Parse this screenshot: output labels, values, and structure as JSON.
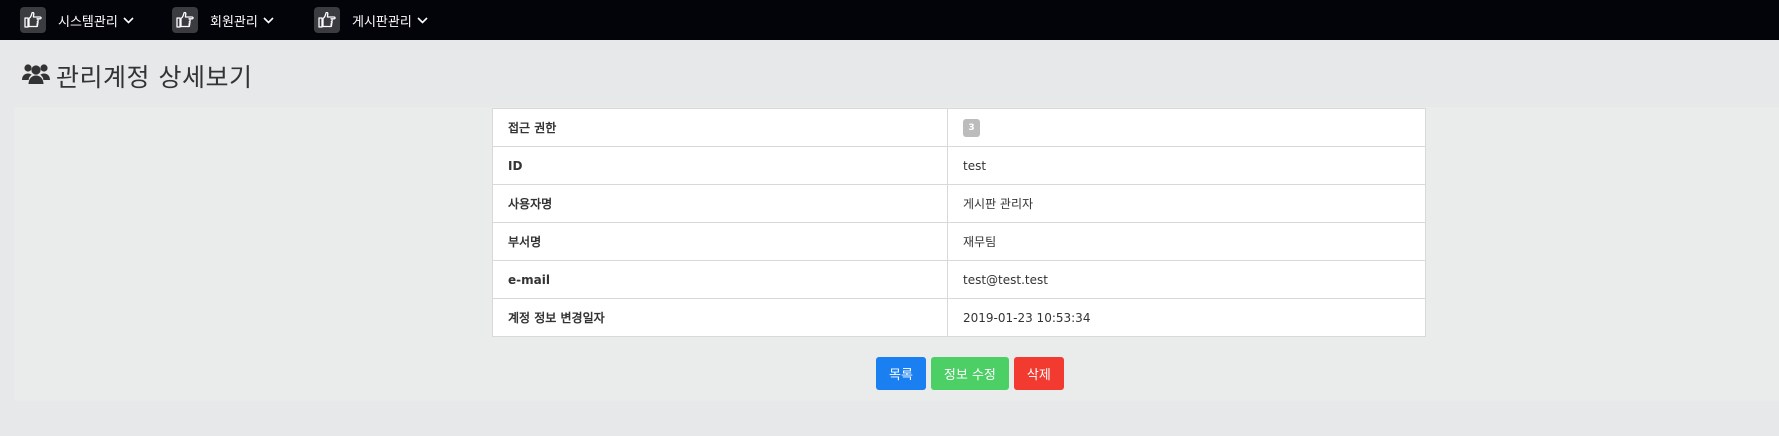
{
  "nav": {
    "items": [
      {
        "label": "시스템관리",
        "icon": "thumbs-up-point-icon"
      },
      {
        "label": "회원관리",
        "icon": "thumbs-up-point-icon"
      },
      {
        "label": "게시판관리",
        "icon": "thumbs-up-point-icon"
      }
    ]
  },
  "header": {
    "icon": "users-icon",
    "title": "관리계정 상세보기"
  },
  "detail": {
    "rows": [
      {
        "label": "접근 권한",
        "value": "3",
        "is_badge": true
      },
      {
        "label": "ID",
        "value": "test"
      },
      {
        "label": "사용자명",
        "value": "게시판 관리자"
      },
      {
        "label": "부서명",
        "value": "재무팀"
      },
      {
        "label": "e-mail",
        "value": "test@test.test"
      },
      {
        "label": "계정 정보 변경일자",
        "value": "2019-01-23 10:53:34"
      }
    ]
  },
  "actions": {
    "list_label": "목록",
    "edit_label": "정보 수정",
    "delete_label": "삭제"
  },
  "colors": {
    "nav_bg": "#03030a",
    "list_button": "#1a7ff0",
    "edit_button": "#4cd066",
    "delete_button": "#f23a30",
    "badge": "#bcbcbc"
  }
}
